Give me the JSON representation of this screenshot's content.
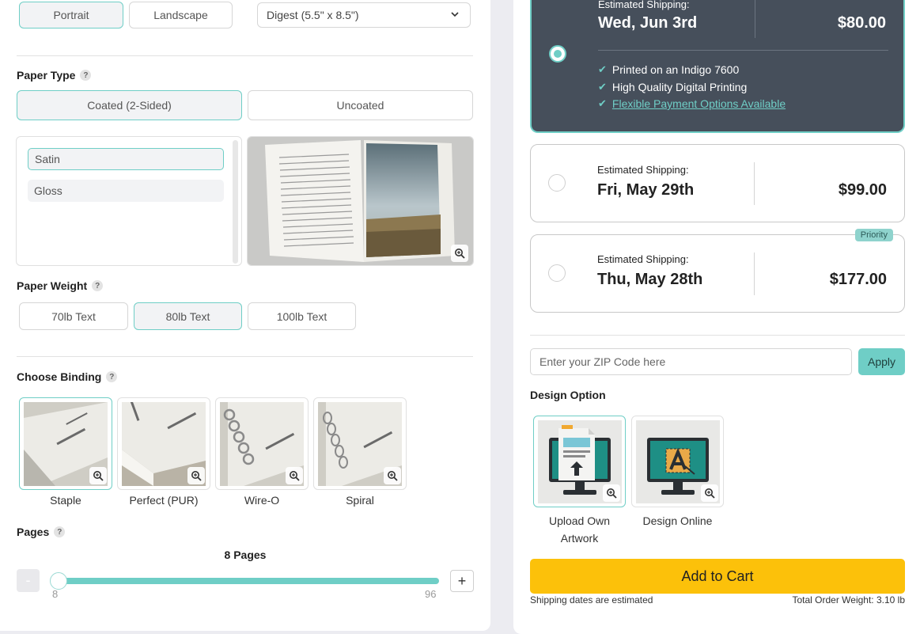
{
  "orientation": {
    "options": [
      "Portrait",
      "Landscape"
    ],
    "selected": "Portrait"
  },
  "size_select": {
    "value": "Digest (5.5\" x 8.5\")"
  },
  "paper_type": {
    "label": "Paper Type",
    "help": "?",
    "options": [
      "Coated (2-Sided)",
      "Uncoated"
    ],
    "selected": "Coated (2-Sided)"
  },
  "finish": {
    "options": [
      "Satin",
      "Gloss"
    ],
    "selected": "Satin"
  },
  "paper_weight": {
    "label": "Paper Weight",
    "help": "?",
    "options": [
      "70lb Text",
      "80lb Text",
      "100lb Text"
    ],
    "selected": "80lb Text"
  },
  "binding": {
    "label": "Choose Binding",
    "help": "?",
    "options": [
      "Staple",
      "Perfect (PUR)",
      "Wire-O",
      "Spiral"
    ],
    "selected": "Staple"
  },
  "pages": {
    "label": "Pages",
    "help": "?",
    "count_text": "8 Pages",
    "min": "8",
    "max": "96",
    "value": 8,
    "minus": "-",
    "plus": "+"
  },
  "shipping": [
    {
      "est_label": "Estimated Shipping:",
      "date": "Wed, Jun 3rd",
      "price": "$80.00",
      "selected": true,
      "features": [
        "Printed on an Indigo 7600",
        "High Quality Digital Printing",
        "Flexible Payment Options Available"
      ]
    },
    {
      "est_label": "Estimated Shipping:",
      "date": "Fri, May 29th",
      "price": "$99.00",
      "selected": false
    },
    {
      "est_label": "Estimated Shipping:",
      "date": "Thu, May 28th",
      "price": "$177.00",
      "selected": false,
      "badge": "Priority"
    }
  ],
  "zip": {
    "placeholder": "Enter your ZIP Code here",
    "apply_label": "Apply"
  },
  "design_option": {
    "label": "Design Option",
    "options": [
      "Upload Own Artwork",
      "Design Online"
    ],
    "selected": "Upload Own Artwork"
  },
  "cart": {
    "label": "Add to Cart",
    "note_left": "Shipping dates are estimated",
    "note_right": "Total Order Weight: 3.10 lb"
  },
  "colors": {
    "accent": "#6fcec6",
    "dark_card": "#464f5b",
    "cart": "#fcc10a"
  }
}
